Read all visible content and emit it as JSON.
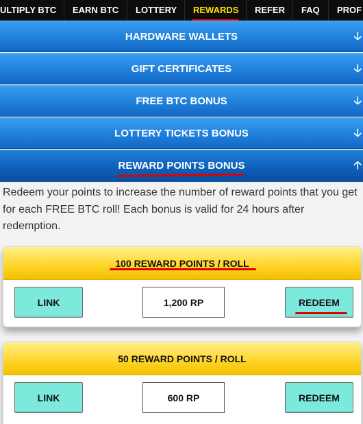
{
  "nav": {
    "items": [
      {
        "label": "ULTIPLY BTC"
      },
      {
        "label": "EARN BTC"
      },
      {
        "label": "LOTTERY"
      },
      {
        "label": "REWARDS"
      },
      {
        "label": "REFER"
      },
      {
        "label": "FAQ"
      },
      {
        "label": "PROF"
      }
    ],
    "active": "REWARDS"
  },
  "accordion": {
    "items": [
      {
        "label": "HARDWARE WALLETS",
        "arrow": "🡣"
      },
      {
        "label": "GIFT CERTIFICATES",
        "arrow": "🡣"
      },
      {
        "label": "FREE BTC BONUS",
        "arrow": "🡣"
      },
      {
        "label": "LOTTERY TICKETS BONUS",
        "arrow": "🡣"
      },
      {
        "label": "REWARD POINTS BONUS",
        "arrow": "🡡"
      }
    ]
  },
  "description": "Redeem your points to increase the number of reward points that you get for each FREE BTC roll! Each bonus is valid for 24 hours after redemption.",
  "bonuses": [
    {
      "title": "100 REWARD POINTS / ROLL",
      "link_label": "LINK",
      "cost": "1,200 RP",
      "redeem_label": "REDEEM"
    },
    {
      "title": "50 REWARD POINTS / ROLL",
      "link_label": "LINK",
      "cost": "600 RP",
      "redeem_label": "REDEEM"
    }
  ],
  "colors": {
    "nav_bg": "#0d0d0d",
    "nav_active": "#ffe000",
    "accordion_blue": "#1f80dc",
    "card_header_yellow": "#ffd426",
    "button_teal": "#7de8dc",
    "annotation_red": "#e00000"
  }
}
